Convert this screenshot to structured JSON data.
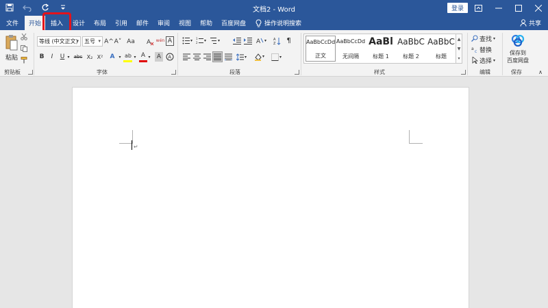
{
  "titlebar": {
    "title": "文档2 - Word",
    "login_label": "登录",
    "colors": {
      "background": "#2b579a"
    }
  },
  "tabs": [
    {
      "label": "文件"
    },
    {
      "label": "开始",
      "active": true
    },
    {
      "label": "插入",
      "highlighted": true
    },
    {
      "label": "设计"
    },
    {
      "label": "布局"
    },
    {
      "label": "引用"
    },
    {
      "label": "邮件"
    },
    {
      "label": "审阅"
    },
    {
      "label": "视图"
    },
    {
      "label": "帮助"
    },
    {
      "label": "百度网盘"
    }
  ],
  "tell_me": "操作说明搜索",
  "share_label": "共享",
  "clipboard": {
    "paste_label": "粘贴",
    "group_label": "剪贴板"
  },
  "font": {
    "font_name": "等线 (中文正文)",
    "font_size": "五号",
    "group_label": "字体",
    "bold": "B",
    "italic": "I",
    "underline": "U",
    "strike": "abc",
    "subscript": "X₂",
    "superscript": "X²",
    "grow": "A^",
    "shrink": "A˅",
    "case": "Aa",
    "text_effect": "A",
    "highlight": "ab",
    "font_color": "A",
    "char_shading": "A",
    "phonetic": "wén",
    "char_border": "A"
  },
  "paragraph": {
    "group_label": "段落"
  },
  "styles": {
    "group_label": "样式",
    "items": [
      {
        "sample": "AaBbCcDd",
        "name": "正文",
        "selected": true
      },
      {
        "sample": "AaBbCcDd",
        "name": "无间隔"
      },
      {
        "sample": "AaBl",
        "name": "标题 1"
      },
      {
        "sample": "AaBbC",
        "name": "标题 2"
      },
      {
        "sample": "AaBbC",
        "name": "标题"
      }
    ]
  },
  "editing": {
    "group_label": "编辑",
    "find": "查找",
    "replace": "替换",
    "select": "选择"
  },
  "save": {
    "label_line1": "保存到",
    "label_line2": "百度网盘",
    "group_label": "保存"
  },
  "colors": {
    "accent": "#2b579a",
    "highlight_box": "#e4131b",
    "font_color_bar": "#e00000",
    "highlight_color_bar": "#ffff00"
  }
}
